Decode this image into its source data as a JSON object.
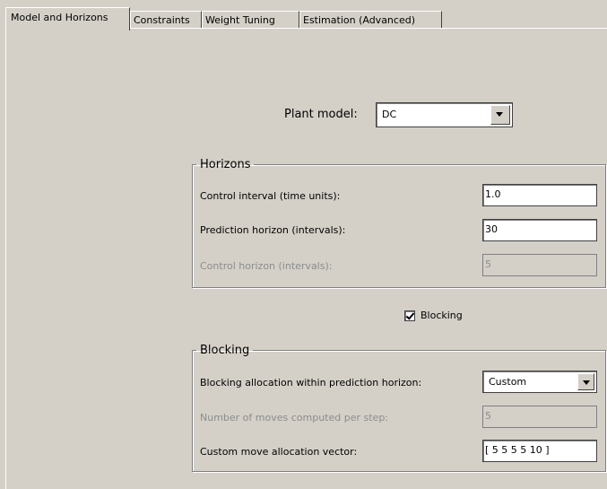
{
  "tabs": [
    {
      "label": "Model and Horizons"
    },
    {
      "label": "Constraints"
    },
    {
      "label": "Weight Tuning"
    },
    {
      "label": "Estimation (Advanced)"
    }
  ],
  "plant": {
    "label": "Plant model:",
    "value": "DC"
  },
  "horizons": {
    "legend": "Horizons",
    "control_interval_label": "Control interval (time units):",
    "control_interval_value": "1.0",
    "prediction_label": "Prediction horizon (intervals):",
    "prediction_value": "30",
    "control_horizon_label": "Control horizon (intervals):",
    "control_horizon_value": "5"
  },
  "blocking_checkbox": {
    "label": "Blocking",
    "checked": true
  },
  "blocking": {
    "legend": "Blocking",
    "allocation_label": "Blocking allocation within prediction horizon:",
    "allocation_value": "Custom",
    "moves_label": "Number of moves computed per step:",
    "moves_value": "5",
    "vector_label": "Custom move allocation vector:",
    "vector_value": "[ 5 5 5 5 10 ]"
  }
}
